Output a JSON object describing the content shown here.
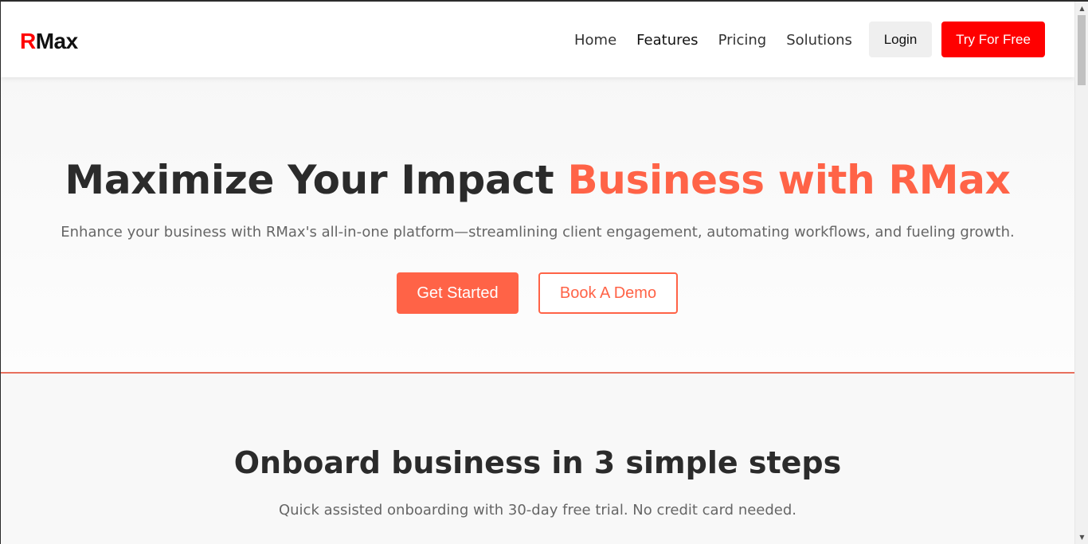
{
  "header": {
    "logo_first": "R",
    "logo_rest": "Max",
    "nav": [
      {
        "label": "Home"
      },
      {
        "label": "Features"
      },
      {
        "label": "Pricing"
      },
      {
        "label": "Solutions"
      }
    ],
    "login_label": "Login",
    "try_label": "Try For Free"
  },
  "hero": {
    "title_main": "Maximize Your Impact ",
    "title_accent": "Business with RMax",
    "subtitle": "Enhance your business with RMax's all-in-one platform—streamlining client engagement, automating workflows, and fueling growth.",
    "primary_cta": "Get Started",
    "secondary_cta": "Book A Demo"
  },
  "steps": {
    "title": "Onboard business in 3 simple steps",
    "subtitle": "Quick assisted onboarding with 30-day free trial. No credit card needed."
  },
  "scrollbar": {
    "up_icon": "▲",
    "down_icon": "▼"
  },
  "colors": {
    "brand_red": "#ff0000",
    "accent": "#ff6347"
  }
}
